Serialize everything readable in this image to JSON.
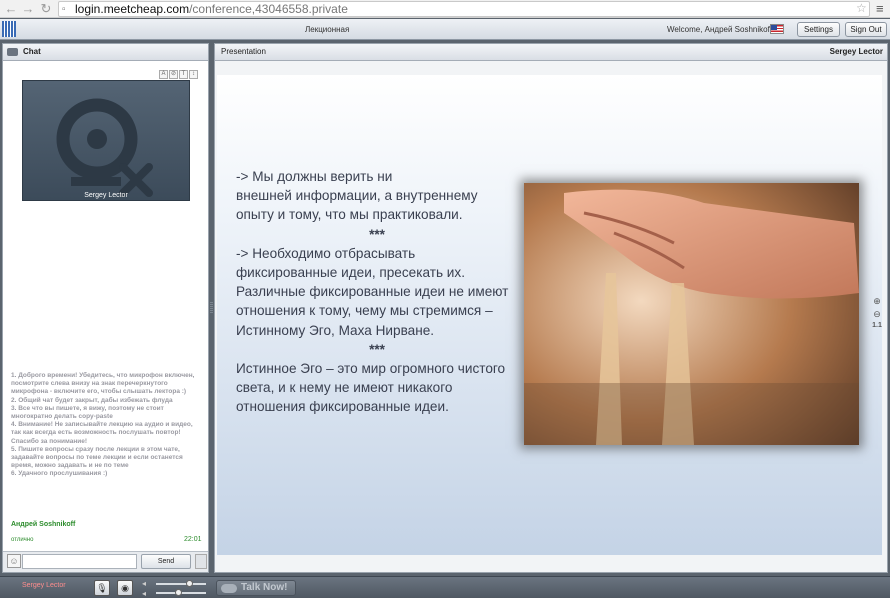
{
  "browser": {
    "url_host": "login.meetcheap.com",
    "url_path": "/conference,43046558.private"
  },
  "app": {
    "title": "Лекционная",
    "welcome": "Welcome, Андрей Soshnikoff",
    "settings_label": "Settings",
    "signout_label": "Sign Out"
  },
  "chat": {
    "header": "Chat",
    "video_label": "Sergey Lector",
    "messages": [
      "1. Доброго времени! Убедитесь, что микрофон включен, посмотрите слева внизу на знак перечеркнутого микрофона - включите его, чтобы слышать лектора :)",
      "2. Общий чат будет закрыт, дабы избежать флуда",
      "3. Все что вы пишете, я вижу, поэтому не стоит многократно делать copy-paste",
      "4. Внимание! Не записывайте лекцию на аудио и видео, так как всегда есть возможность послушать повтор! Спасибо за понимание!",
      "5. Пишите вопросы сразу после лекции в этом чате, задавайте вопросы по теме лекции и если останется время, можно задавать и не по теме",
      "6. Удачного прослушивания :)"
    ],
    "last_sender": "Андрей Soshnikoff",
    "last_message": "отлично",
    "last_time": "22:01",
    "send_label": "Send",
    "input_value": ""
  },
  "presentation": {
    "header": "Presentation",
    "presenter": "Sergey Lector",
    "zoom_level": "1.1",
    "slide_lines": [
      "-> Мы должны верить ни",
      " внешней информации, а внутреннему опыту и тому, что мы практиковали.",
      "***",
      "-> Необходимо отбрасывать фиксированные идеи, пресекать их.",
      "Различные фиксированные идеи не имеют отношения к тому, чему мы стремимся – Истинному Эго, Маха Нирване.",
      "***",
      "Истинное Эго – это мир огромного чистого света, и к нему не имеют никакого отношения фиксированные идеи."
    ]
  },
  "bottom": {
    "user": "Sergey Lector",
    "talk_label": "Talk Now!"
  }
}
